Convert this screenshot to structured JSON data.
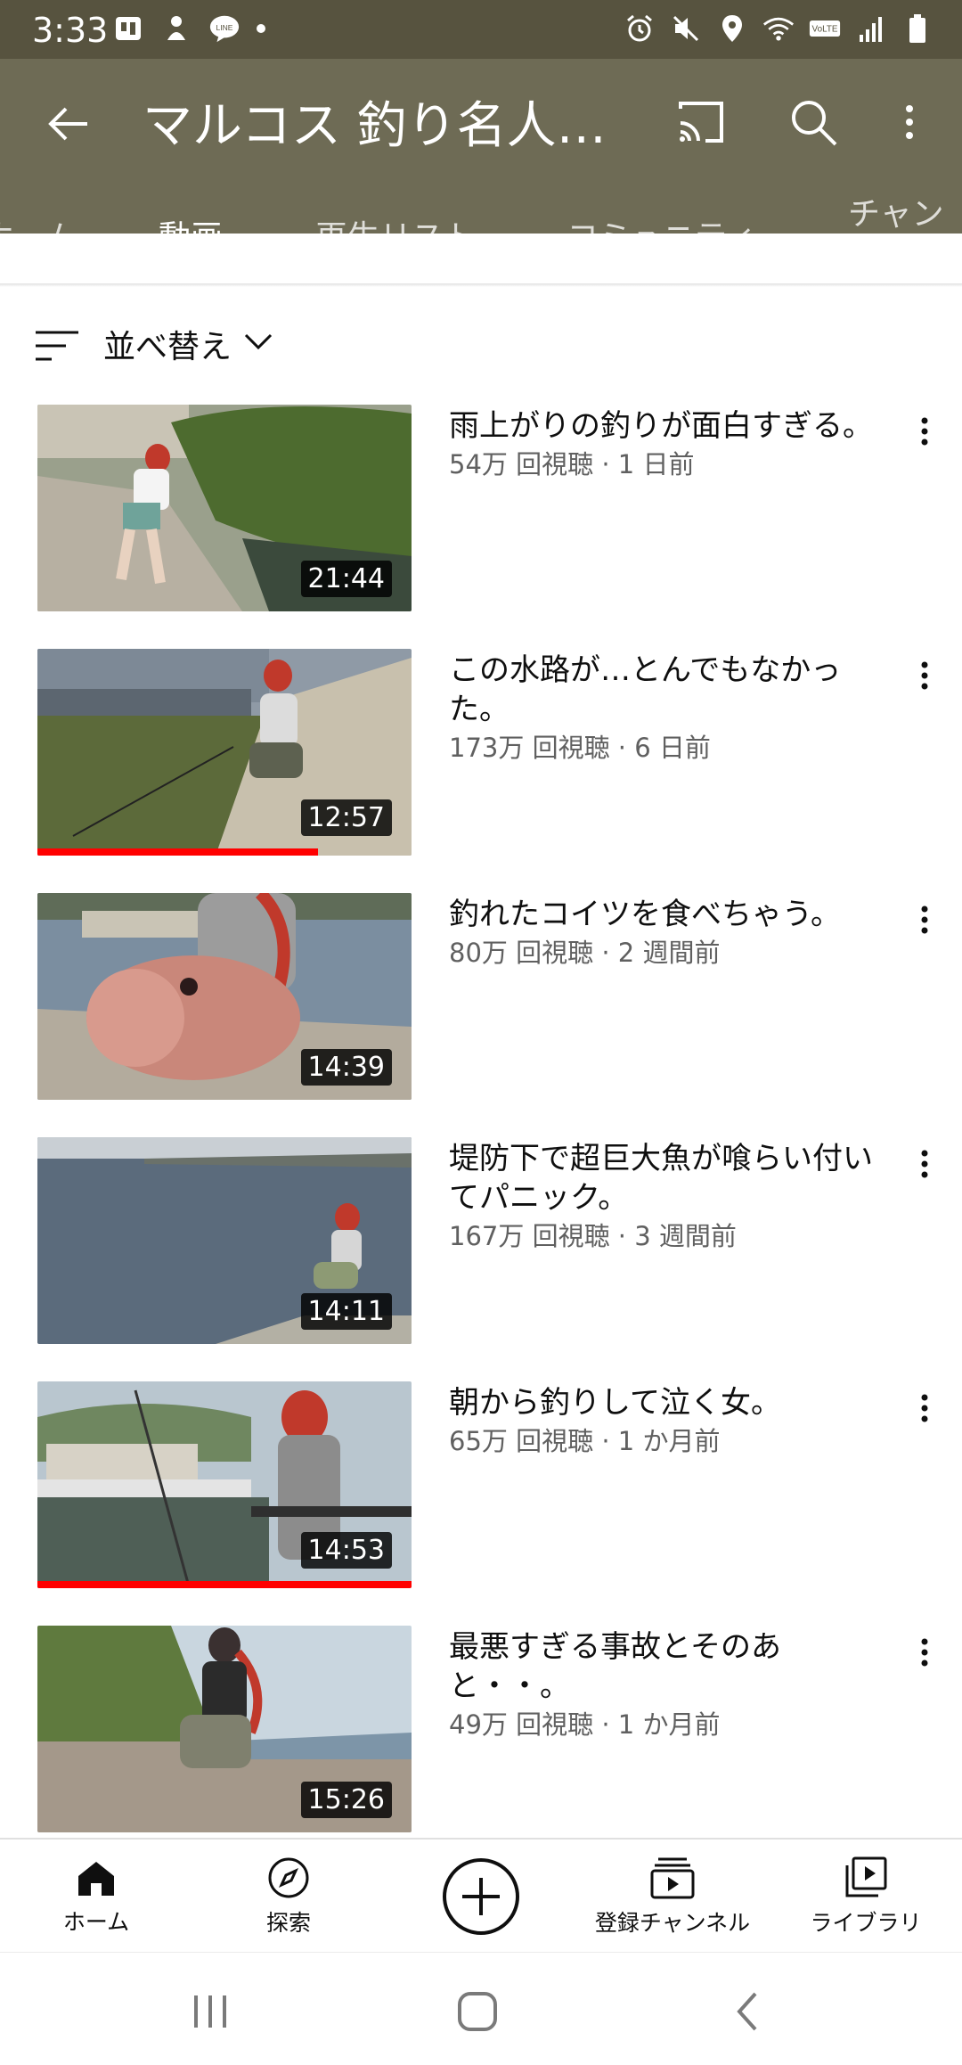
{
  "status_bar": {
    "time": "3:33"
  },
  "app_bar": {
    "title": "マルコス 釣り名人への…"
  },
  "tabs": [
    {
      "label": "ホーム"
    },
    {
      "label": "動画"
    },
    {
      "label": "再生リスト"
    },
    {
      "label": "コミュニティ"
    },
    {
      "label": "チャンネ"
    }
  ],
  "sort": {
    "label": "並べ替え"
  },
  "videos": [
    {
      "title": "雨上がりの釣りが面白すぎる。",
      "meta": "54万 回視聴 · 1 日前",
      "duration": "21:44",
      "watched_fraction": 0
    },
    {
      "title": "この水路が…とんでもなかった。",
      "meta": "173万 回視聴 · 6 日前",
      "duration": "12:57",
      "watched_fraction": 0.75
    },
    {
      "title": "釣れたコイツを食べちゃう。",
      "meta": "80万 回視聴 · 2 週間前",
      "duration": "14:39",
      "watched_fraction": 0
    },
    {
      "title": "堤防下で超巨大魚が喰らい付いてパニック。",
      "meta": "167万 回視聴 · 3 週間前",
      "duration": "14:11",
      "watched_fraction": 0
    },
    {
      "title": "朝から釣りして泣く女。",
      "meta": "65万 回視聴 · 1 か月前",
      "duration": "14:53",
      "watched_fraction": 1
    },
    {
      "title": "最悪すぎる事故とそのあと・・。",
      "meta": "49万 回視聴 · 1 か月前",
      "duration": "15:26",
      "watched_fraction": 0
    }
  ],
  "bottom_nav": [
    {
      "label": "ホーム",
      "icon": "home-icon"
    },
    {
      "label": "探索",
      "icon": "explore-icon"
    },
    {
      "label": "",
      "icon": "create-icon"
    },
    {
      "label": "登録チャンネル",
      "icon": "subscriptions-icon"
    },
    {
      "label": "ライブラリ",
      "icon": "library-icon"
    }
  ],
  "colors": {
    "header": "#6e6b55",
    "status": "#57533f",
    "progress": "#ff0000"
  }
}
